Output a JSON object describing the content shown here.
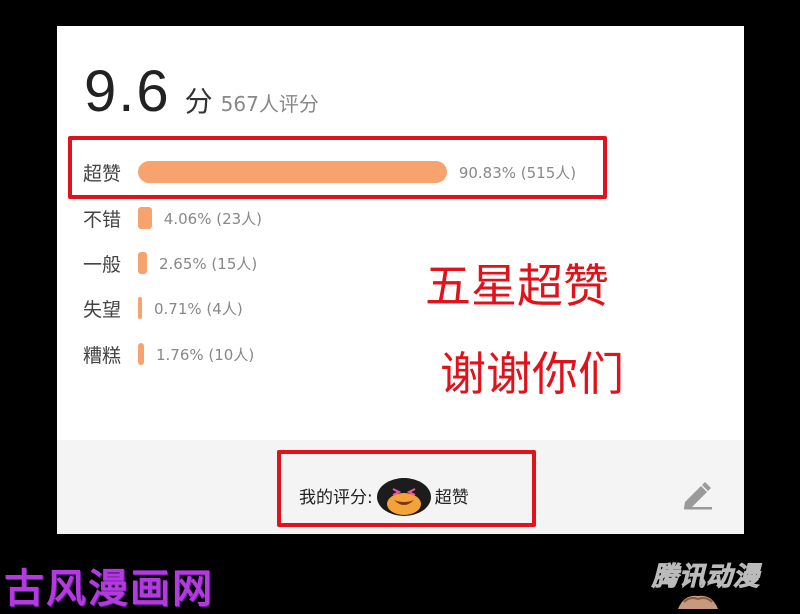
{
  "rating": {
    "score": "9.6",
    "unit": "分",
    "count_text": "567人评分"
  },
  "distribution": [
    {
      "label": "超赞",
      "value_text": "90.83% (515人)",
      "percent": 90.83,
      "color": "#f7a36f"
    },
    {
      "label": "不错",
      "value_text": "4.06% (23人)",
      "percent": 4.06,
      "color": "#f7a36f"
    },
    {
      "label": "一般",
      "value_text": "2.65% (15人)",
      "percent": 2.65,
      "color": "#f7a36f"
    },
    {
      "label": "失望",
      "value_text": "0.71% (4人)",
      "percent": 0.71,
      "color": "#f7a36f"
    },
    {
      "label": "糟糕",
      "value_text": "1.76% (10人)",
      "percent": 1.76,
      "color": "#f7a36f"
    }
  ],
  "annotations": {
    "line1": "五星超赞",
    "line2": "谢谢你们",
    "color": "#e0121b"
  },
  "footer": {
    "my_rating_label": "我的评分:",
    "my_rating_value": "超赞",
    "avatar_icon": "penguin-avatar-icon",
    "edit_icon": "pencil-icon"
  },
  "watermarks": {
    "left": "古风漫画网",
    "right": "腾讯动漫"
  }
}
